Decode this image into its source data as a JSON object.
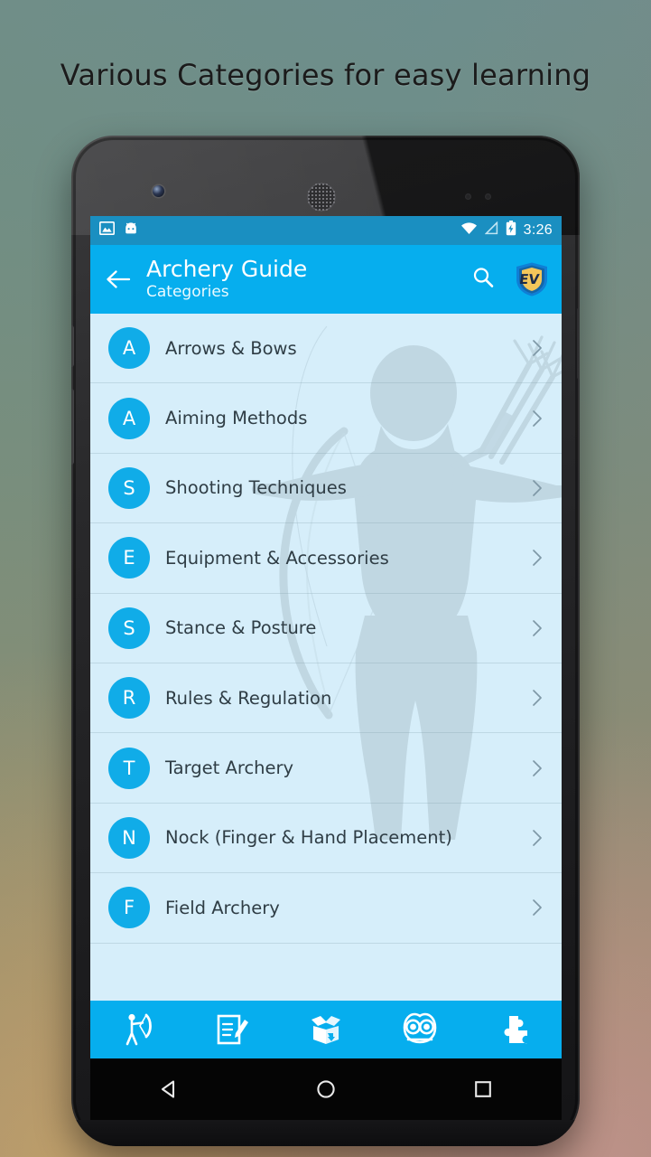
{
  "promo": {
    "headline": "Various Categories for easy learning"
  },
  "background": {
    "top_color": "#6d8e8d",
    "bottom_left_color": "#c4a068",
    "bottom_right_color": "#c6968d"
  },
  "theme": {
    "primary": "#06AEEE",
    "status_bar": "#1a8fc1",
    "list_bg": "#D6EEFA",
    "avatar": "#10ACE8",
    "text": "#2f3d45"
  },
  "status_bar": {
    "left_icons": [
      "image-icon",
      "android-head-icon"
    ],
    "right_icons": [
      "wifi-icon",
      "signal-off-icon",
      "battery-charging-icon"
    ],
    "time": "3:26"
  },
  "app_bar": {
    "back_icon": "back-arrow-icon",
    "title": "Archery Guide",
    "subtitle": "Categories",
    "search_icon": "search-icon",
    "logo_text": "EV",
    "logo_icon": "ev-shield-logo"
  },
  "categories": [
    {
      "initial": "A",
      "label": "Arrows & Bows"
    },
    {
      "initial": "A",
      "label": "Aiming Methods"
    },
    {
      "initial": "S",
      "label": "Shooting Techniques"
    },
    {
      "initial": "E",
      "label": "Equipment & Accessories"
    },
    {
      "initial": "S",
      "label": "Stance & Posture"
    },
    {
      "initial": "R",
      "label": "Rules & Regulation"
    },
    {
      "initial": "T",
      "label": "Target Archery"
    },
    {
      "initial": "N",
      "label": "Nock (Finger & Hand Placement)"
    },
    {
      "initial": "F",
      "label": "Field Archery"
    }
  ],
  "bottom_nav": [
    {
      "icon": "archer-icon",
      "name": "guide"
    },
    {
      "icon": "quiz-note-pencil-icon",
      "name": "quiz"
    },
    {
      "icon": "open-box-icon",
      "name": "package"
    },
    {
      "icon": "owl-icon",
      "name": "learn"
    },
    {
      "icon": "puzzle-piece-icon",
      "name": "extras"
    }
  ],
  "android_nav": {
    "back": "android-back-icon",
    "home": "android-home-icon",
    "recents": "android-recents-icon"
  }
}
